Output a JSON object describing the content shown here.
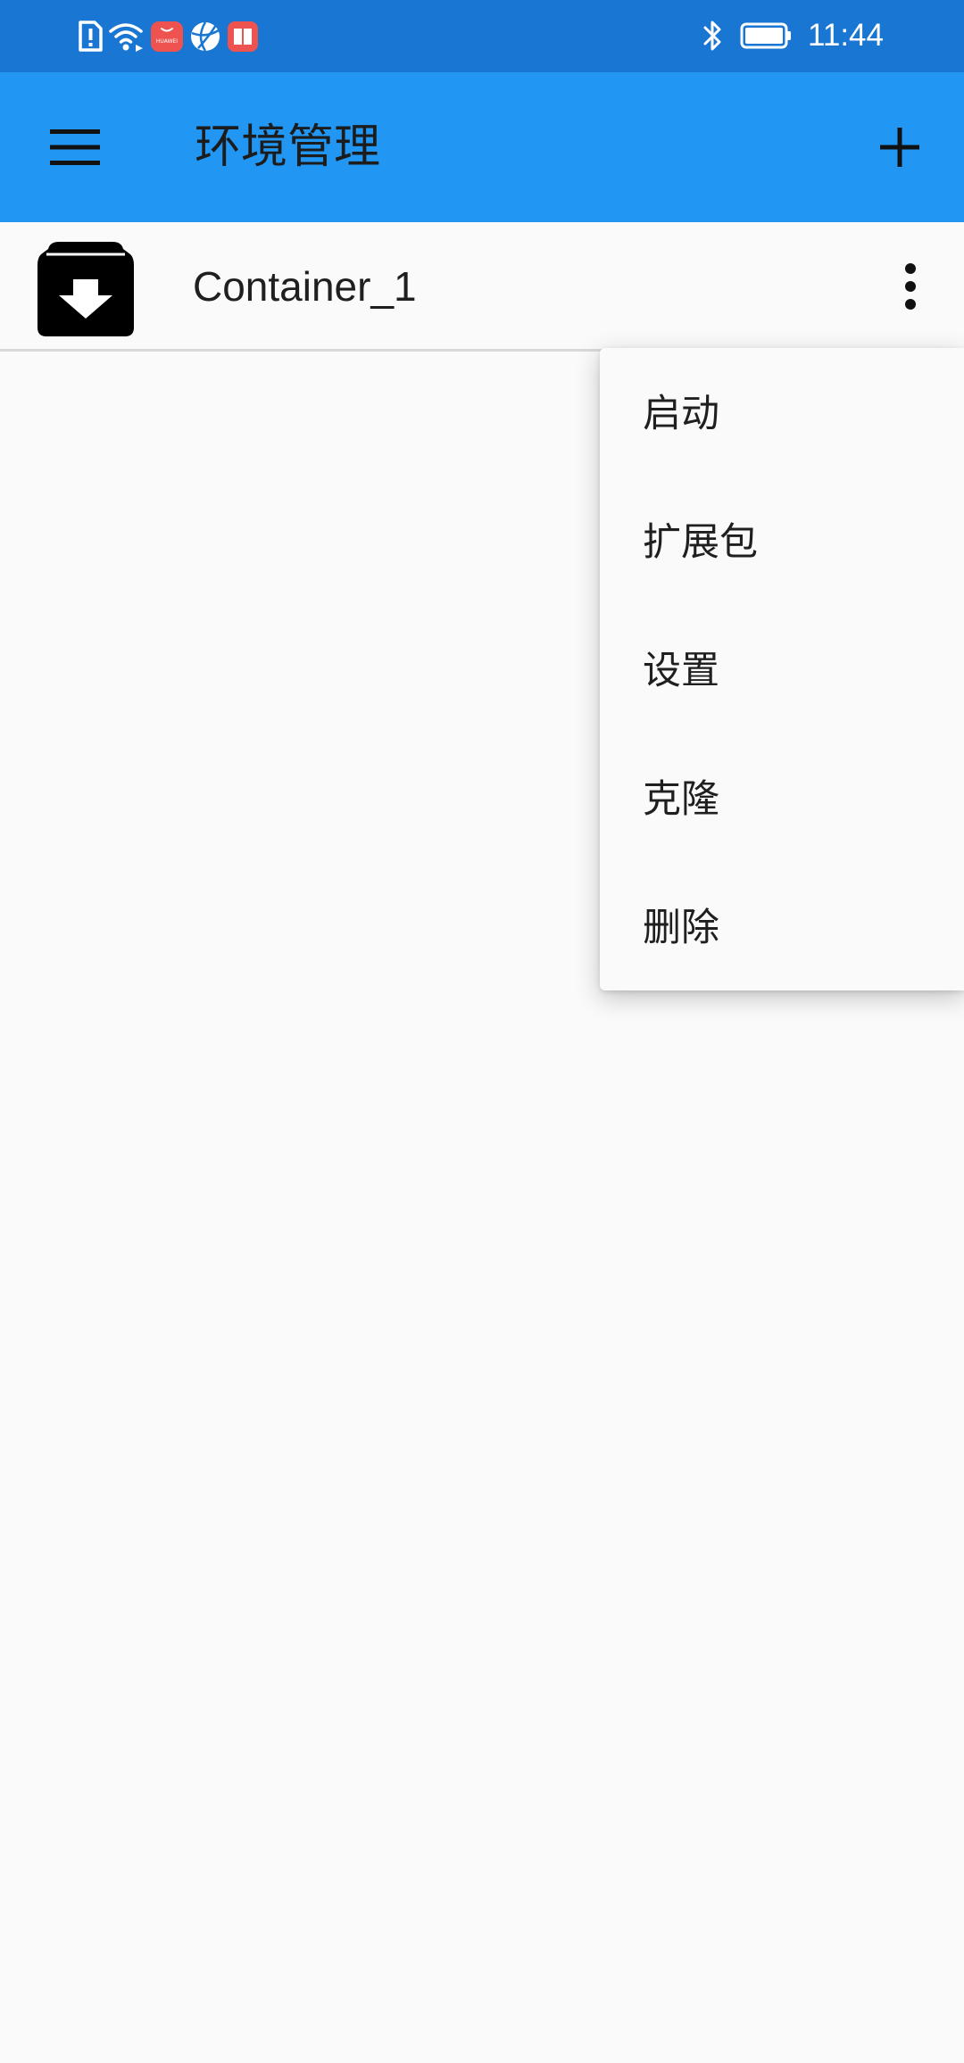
{
  "status_bar": {
    "time": "11:44",
    "icons": [
      "sim-alert-icon",
      "wifi-icon",
      "huawei-store-icon",
      "browser-icon",
      "reader-icon",
      "bluetooth-icon",
      "battery-icon"
    ],
    "badge_text": "HUAWEI"
  },
  "app_bar": {
    "title": "环境管理",
    "menu_icon": "hamburger-menu-icon",
    "add_icon": "plus-icon"
  },
  "containers": [
    {
      "name": "Container_1",
      "icon": "archive-download-icon"
    }
  ],
  "context_menu": {
    "items": [
      {
        "label": "启动"
      },
      {
        "label": "扩展包"
      },
      {
        "label": "设置"
      },
      {
        "label": "克隆"
      },
      {
        "label": "删除"
      }
    ]
  },
  "colors": {
    "status_bar": "#1976d2",
    "app_bar": "#2196f3",
    "background": "#fafafa",
    "text": "#1f1f1f"
  }
}
